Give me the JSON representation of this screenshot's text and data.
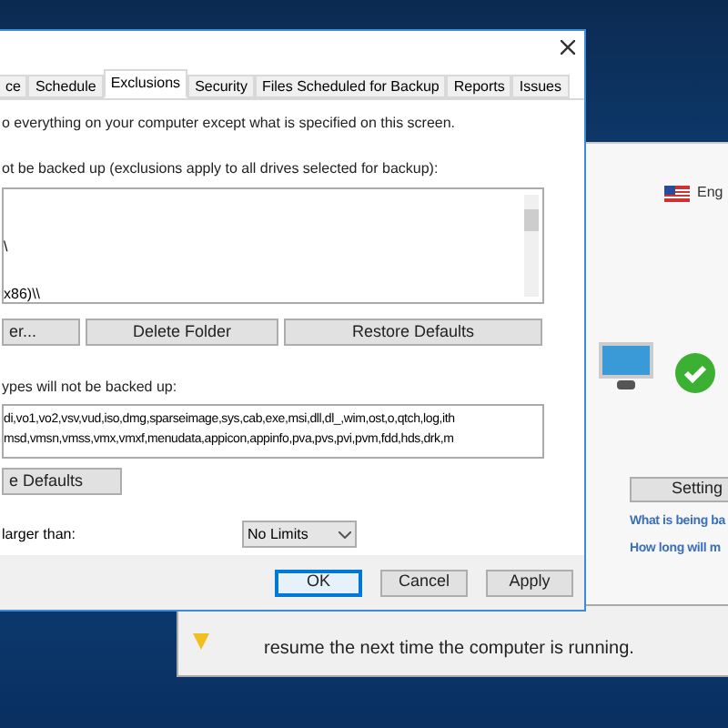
{
  "dialog": {
    "tabs": [
      {
        "label": "ce",
        "selected": false
      },
      {
        "label": "Schedule",
        "selected": false
      },
      {
        "label": "Exclusions",
        "selected": true
      },
      {
        "label": "Security",
        "selected": false
      },
      {
        "label": "Files Scheduled for Backup",
        "selected": false
      },
      {
        "label": "Reports",
        "selected": false
      },
      {
        "label": "Issues",
        "selected": false
      }
    ],
    "intro": "o everything on your computer except what is specified on this screen.",
    "folders_label": "ot be backed up (exclusions apply to all drives selected for backup):",
    "folders": [
      "\\",
      "x86)\\\\"
    ],
    "folder_buttons": [
      "er...",
      "Delete Folder",
      "Restore Defaults"
    ],
    "types_label": "ypes will not be backed up:",
    "types": [
      "di,vo1,vo2,vsv,vud,iso,dmg,sparseimage,sys,cab,exe,msi,dll,dl_,wim,ost,o,qtch,log,ith",
      "msd,vmsn,vmss,vmx,vmxf,menudata,appicon,appinfo,pva,pvs,pvi,pvm,fdd,hds,drk,m"
    ],
    "types_button": "e Defaults",
    "size_label": "larger than:",
    "size_value": "No Limits",
    "footer_buttons": [
      {
        "label": "OK",
        "selected": true
      },
      {
        "label": "Cancel",
        "selected": false
      },
      {
        "label": "Apply",
        "selected": false
      }
    ]
  },
  "back_window": {
    "language": "Eng",
    "settings_button": "Setting",
    "links": [
      "What is being ba",
      "How long will m"
    ]
  },
  "notice": {
    "text": "resume the next time the computer is running."
  }
}
